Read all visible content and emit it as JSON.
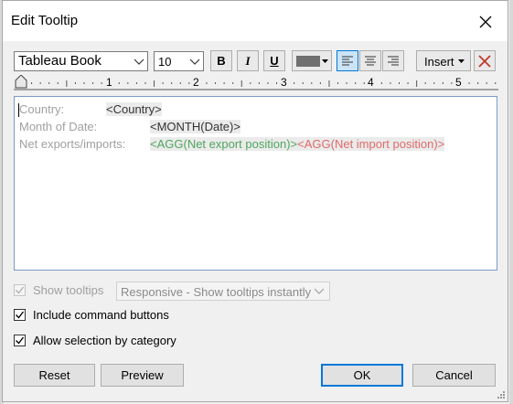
{
  "window": {
    "title": "Edit Tooltip"
  },
  "toolbar": {
    "font": "Tableau Book",
    "size": "10",
    "bold": "B",
    "italic": "I",
    "underline": "U",
    "text_color": "#707070",
    "insert_label": "Insert",
    "alignment": "left"
  },
  "ruler": {
    "numbers": [
      "1",
      "2",
      "3",
      "4",
      "5"
    ]
  },
  "editor": {
    "lines": [
      {
        "label": "Country:",
        "fields": [
          "<Country>"
        ]
      },
      {
        "label": "Month of Date:",
        "fields": [
          "<MONTH(Date)>"
        ]
      },
      {
        "label": "Net exports/imports:",
        "fields": [
          "<AGG(Net export position)>",
          "<AGG(Net import position)>"
        ]
      }
    ],
    "colors": {
      "label": "#a0a0a0",
      "export": "#4fa65f",
      "import": "#e06a6a"
    }
  },
  "options": {
    "show_tooltips": {
      "label": "Show tooltips",
      "checked": true,
      "enabled": false
    },
    "tooltip_mode": "Responsive - Show tooltips instantly",
    "include_command_buttons": {
      "label": "Include command buttons",
      "checked": true
    },
    "allow_selection": {
      "label": "Allow selection by category",
      "checked": true
    }
  },
  "buttons": {
    "reset": "Reset",
    "preview": "Preview",
    "ok": "OK",
    "cancel": "Cancel"
  },
  "icons": [
    "close-icon",
    "chevron-down-icon",
    "align-left-icon",
    "align-center-icon",
    "align-right-icon",
    "clear-x-icon",
    "checkmark-icon",
    "resize-grip-icon"
  ]
}
